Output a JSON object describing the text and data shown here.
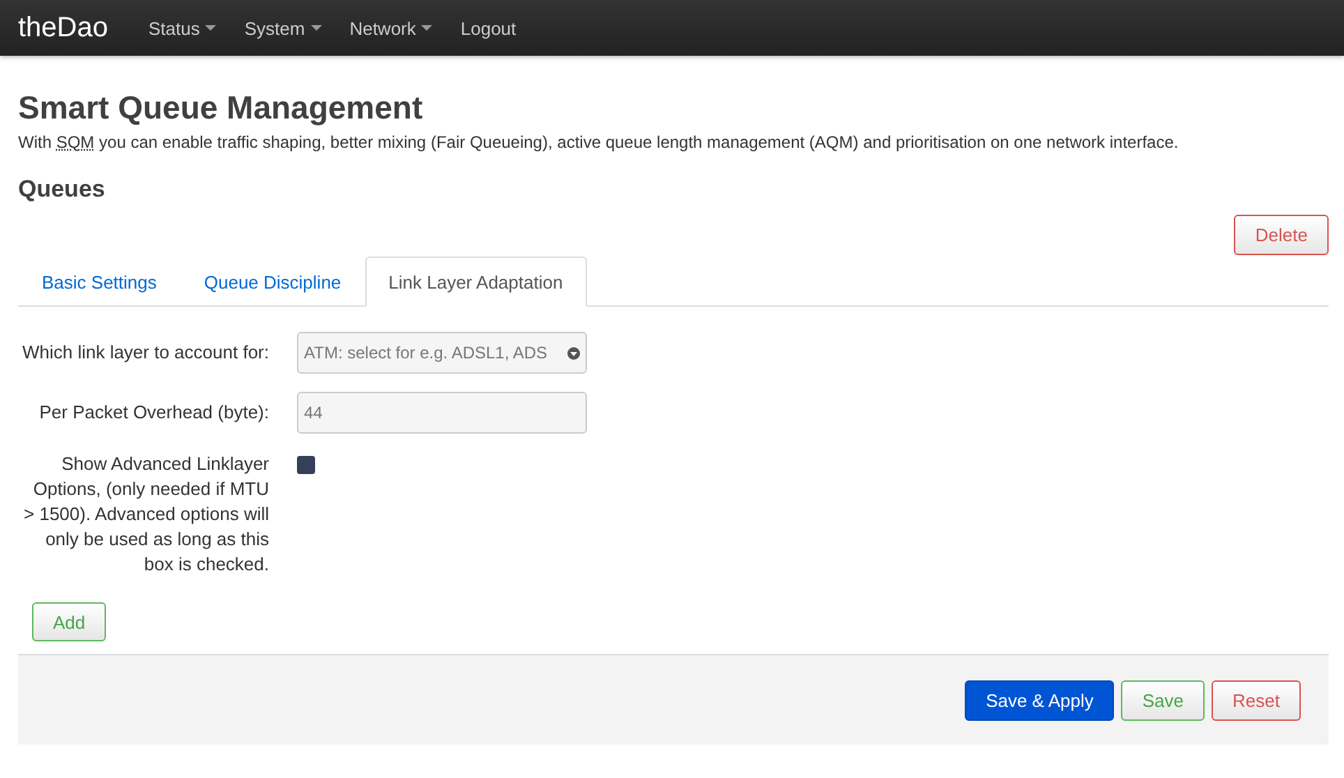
{
  "navbar": {
    "brand": "theDao",
    "menu": [
      {
        "label": "Status",
        "dropdown": true
      },
      {
        "label": "System",
        "dropdown": true
      },
      {
        "label": "Network",
        "dropdown": true
      },
      {
        "label": "Logout",
        "dropdown": false
      }
    ]
  },
  "title": "Smart Queue Management",
  "description": {
    "before": "With ",
    "abbr": "SQM",
    "after": " you can enable traffic shaping, better mixing (Fair Queueing), active queue length management (AQM) and prioritisation on one network interface."
  },
  "section": {
    "title": "Queues",
    "delete_button": "Delete"
  },
  "tabs": [
    {
      "label": "Basic Settings",
      "selected": false
    },
    {
      "label": "Queue Discipline",
      "selected": false
    },
    {
      "label": "Link Layer Adaptation",
      "selected": true
    }
  ],
  "fields": [
    {
      "kind": "select",
      "label": "Which link layer to account for:",
      "value": "ATM: select for e.g. ADSL1, ADS"
    },
    {
      "kind": "input",
      "label": "Per Packet Overhead (byte):",
      "value": "44"
    },
    {
      "kind": "checkbox",
      "label": "Show Advanced Linklayer Options, (only needed if MTU > 1500). Advanced options will only be used as long as this box is checked.",
      "checked": true
    }
  ],
  "add_button": "Add",
  "footer_buttons": [
    {
      "label": "Save & Apply",
      "kind": "primary"
    },
    {
      "label": "Save",
      "kind": "success"
    },
    {
      "label": "Reset",
      "kind": "danger"
    }
  ]
}
